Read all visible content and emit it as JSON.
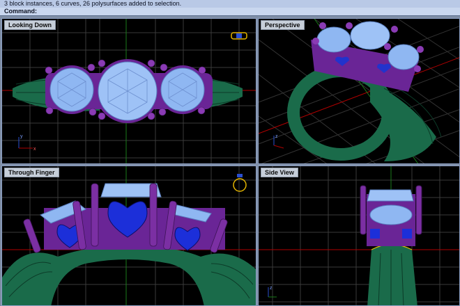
{
  "command": {
    "history": "3 block instances, 6 curves, 26 polysurfaces added to selection.",
    "prompt": "Command:"
  },
  "viewports": [
    {
      "title": "Looking Down"
    },
    {
      "title": "Perspective"
    },
    {
      "title": "Through Finger"
    },
    {
      "title": "Side View"
    }
  ],
  "axes": {
    "x": "x",
    "y": "y",
    "z": "z"
  },
  "colors": {
    "background": "#000000",
    "grid": "#3a3a3a",
    "metal_prongs": "#7b2fa3",
    "band": "#1a6b4a",
    "gems": "#8fb7f2",
    "hearts": "#1c2fd9",
    "axis_x": "#b00000",
    "axis_y": "#1a7a1a",
    "axis_z": "#2a4fd0"
  }
}
